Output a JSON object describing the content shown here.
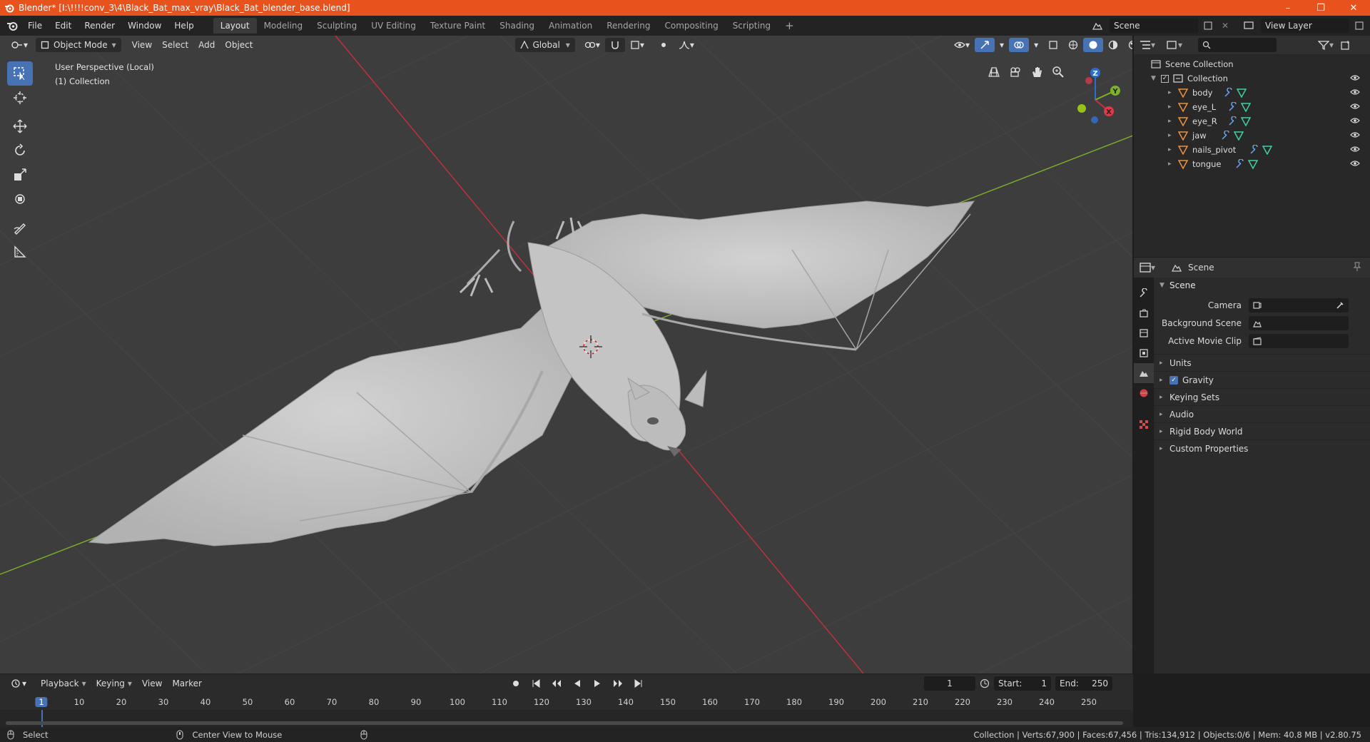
{
  "window": {
    "title": "Blender* [I:\\!!!!conv_3\\4\\Black_Bat_max_vray\\Black_Bat_blender_base.blend]",
    "controls": [
      "–",
      "❐",
      "✕"
    ]
  },
  "menu": {
    "items": [
      "File",
      "Edit",
      "Render",
      "Window",
      "Help"
    ],
    "workspaces": [
      "Layout",
      "Modeling",
      "Sculpting",
      "UV Editing",
      "Texture Paint",
      "Shading",
      "Animation",
      "Rendering",
      "Compositing",
      "Scripting"
    ],
    "active_workspace": "Layout",
    "add_tab": "+",
    "scene": "Scene",
    "view_layer": "View Layer"
  },
  "viewport": {
    "mode": "Object Mode",
    "menus": [
      "View",
      "Select",
      "Add",
      "Object"
    ],
    "orientation": "Global",
    "perspective_label": "User Perspective (Local)",
    "collection_label": "(1) Collection",
    "gizmo_axes": {
      "x": "X",
      "y": "Y",
      "z": "Z"
    },
    "colors": {
      "bg": "#3d3d3d",
      "grid": "#464646",
      "x_axis": "#c8303c",
      "y_axis": "#7cb32a",
      "bat": "#c7c7c7"
    }
  },
  "outliner": {
    "root": "Scene Collection",
    "collection": "Collection",
    "objects": [
      {
        "name": "body"
      },
      {
        "name": "eye_L"
      },
      {
        "name": "eye_R"
      },
      {
        "name": "jaw"
      },
      {
        "name": "nails_pivot"
      },
      {
        "name": "tongue"
      }
    ]
  },
  "properties": {
    "header": "Scene",
    "panel": "Scene",
    "fields": [
      {
        "label": "Camera"
      },
      {
        "label": "Background Scene"
      },
      {
        "label": "Active Movie Clip"
      }
    ],
    "subpanels": [
      "Units",
      "Gravity",
      "Keying Sets",
      "Audio",
      "Rigid Body World",
      "Custom Properties"
    ],
    "gravity_checked": true
  },
  "timeline": {
    "menus": [
      "Playback",
      "Keying",
      "View",
      "Marker"
    ],
    "current_frame": "1",
    "start_label": "Start:",
    "start": "1",
    "end_label": "End:",
    "end": "250",
    "ticks": [
      "1",
      "10",
      "20",
      "30",
      "40",
      "50",
      "60",
      "70",
      "80",
      "90",
      "100",
      "110",
      "120",
      "130",
      "140",
      "150",
      "160",
      "170",
      "180",
      "190",
      "200",
      "210",
      "220",
      "230",
      "240",
      "250"
    ]
  },
  "status": {
    "left1": "Select",
    "left2": "Center View to Mouse",
    "right": "Collection | Verts:67,900 | Faces:67,456 | Tris:134,912 | Objects:0/6 | Mem: 40.8 MB | v2.80.75"
  }
}
